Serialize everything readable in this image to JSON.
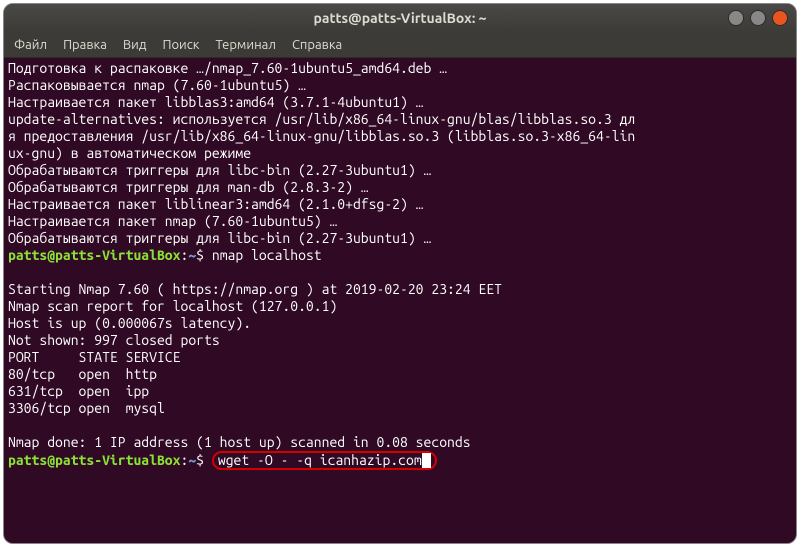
{
  "window": {
    "title": "patts@patts-VirtualBox: ~"
  },
  "menu": {
    "file": "Файл",
    "edit": "Правка",
    "view": "Вид",
    "search": "Поиск",
    "terminal": "Терминал",
    "help": "Справка"
  },
  "term": {
    "l1": "Подготовка к распаковке …/nmap_7.60-1ubuntu5_amd64.deb …",
    "l2": "Распаковывается nmap (7.60-1ubuntu5) …",
    "l3": "Настраивается пакет libblas3:amd64 (3.7.1-4ubuntu1) …",
    "l4": "update-alternatives: используется /usr/lib/x86_64-linux-gnu/blas/libblas.so.3 дл",
    "l5": "я предоставления /usr/lib/x86_64-linux-gnu/libblas.so.3 (libblas.so.3-x86_64-lin",
    "l6": "ux-gnu) в автоматическом режиме",
    "l7": "Обрабатываются триггеры для libc-bin (2.27-3ubuntu1) …",
    "l8": "Обрабатываются триггеры для man-db (2.8.3-2) …",
    "l9": "Настраивается пакет liblinear3:amd64 (2.1.0+dfsg-2) …",
    "l10": "Настраивается пакет nmap (7.60-1ubuntu5) …",
    "l11": "Обрабатываются триггеры для libc-bin (2.27-3ubuntu1) …",
    "prompt_user": "patts@patts-VirtualBox",
    "prompt_sep": ":",
    "prompt_path": "~",
    "prompt_end": "$ ",
    "cmd1": "nmap localhost",
    "blank": "",
    "l12": "Starting Nmap 7.60 ( https://nmap.org ) at 2019-02-20 23:24 EET",
    "l13": "Nmap scan report for localhost (127.0.0.1)",
    "l14": "Host is up (0.000067s latency).",
    "l15": "Not shown: 997 closed ports",
    "l16": "PORT     STATE SERVICE",
    "l17": "80/tcp   open  http",
    "l18": "631/tcp  open  ipp",
    "l19": "3306/tcp open  mysql",
    "l20": "Nmap done: 1 IP address (1 host up) scanned in 0.08 seconds",
    "cmd2": "wget -O - -q icanhazip.com"
  }
}
